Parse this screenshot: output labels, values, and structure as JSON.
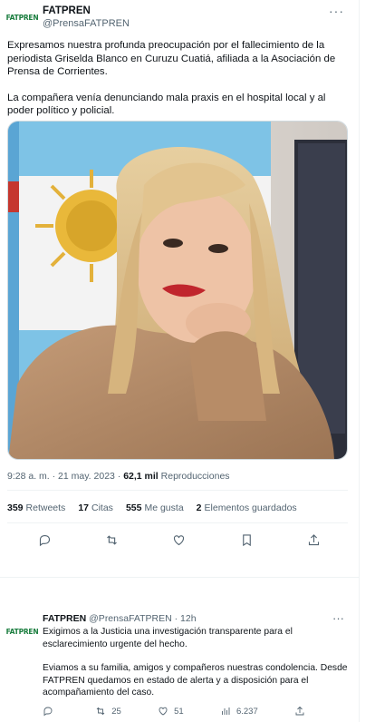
{
  "tweet": {
    "logo_text": "FATPREN",
    "display_name": "FATPREN",
    "handle": "@PrensaFATPREN",
    "more": "···",
    "paragraphs": [
      "Expresamos nuestra profunda preocupación por el fallecimiento de la periodista Griselda Blanco en Curuzu Cuatiá, afiliada a la Asociación de Prensa de Corrientes.",
      "La compañera venía denunciando mala praxis en el hospital local y al poder político y policial."
    ],
    "time": "9:28 a. m. · 21 may. 2023 · ",
    "views_count": "62,1 mil",
    "views_label": " Reproducciones",
    "stats": {
      "retweets_count": "359",
      "retweets_label": "Retweets",
      "quotes_count": "17",
      "quotes_label": "Citas",
      "likes_count": "555",
      "likes_label": "Me gusta",
      "bookmarks_count": "2",
      "bookmarks_label": "Elementos guardados"
    }
  },
  "reply": {
    "logo_text": "FATPREN",
    "display_name": "FATPREN",
    "handle": " @PrensaFATPREN · 12h",
    "more": "···",
    "paragraphs": [
      "Exigimos a la Justicia una investigación transparente para el esclarecimiento urgente del hecho.",
      "Eviamos a su familia, amigos y compañeros nuestras condolencia. Desde FATPREN quedamos en estado de alerta y a disposición para el acompañamiento del caso."
    ],
    "actions": {
      "reply_count": "",
      "retweet_count": "25",
      "like_count": "51",
      "views_count": "6.237"
    }
  },
  "colors": {
    "brand_green": "#1a7d3e",
    "text_primary": "#0f1419",
    "text_secondary": "#536471",
    "border": "#eff3f4"
  },
  "icons": [
    "reply-icon",
    "retweet-icon",
    "like-icon",
    "bookmark-icon",
    "share-icon",
    "views-icon",
    "more-icon"
  ]
}
